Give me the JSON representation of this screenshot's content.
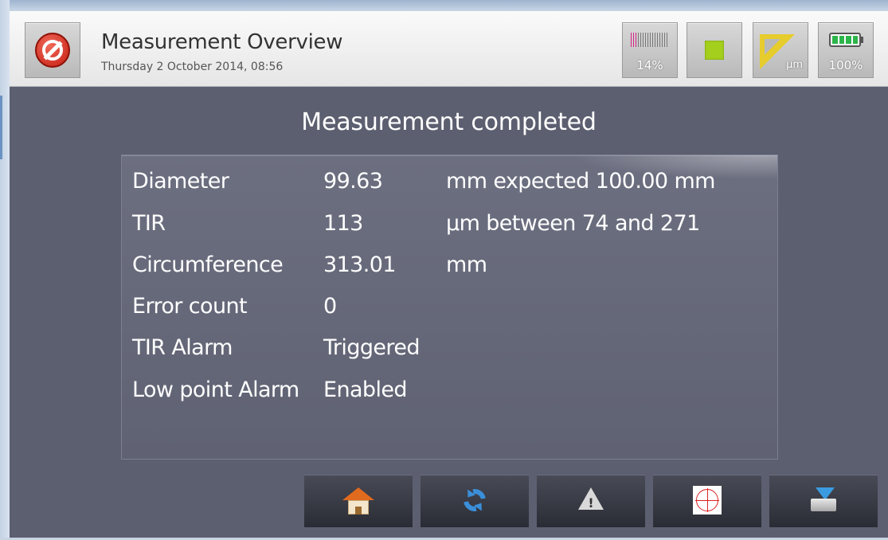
{
  "header": {
    "title": "Measurement Overview",
    "subtitle": "Thursday 2 October 2014, 08:56",
    "storage_level": "14%",
    "storage_fraction": 0.14,
    "unit_label": "µm",
    "battery_level": "100%",
    "battery_fraction": 1.0,
    "status_color": "#a4cf1c",
    "icons": {
      "cancel": "cancel-icon",
      "storage": "storage-bars-icon",
      "status": "status-square-icon",
      "unit": "ruler-icon",
      "battery": "battery-icon"
    }
  },
  "main": {
    "headline": "Measurement completed",
    "rows": [
      {
        "label": "Diameter",
        "value": "99.63",
        "extra": "mm expected 100.00 mm"
      },
      {
        "label": "TIR",
        "value": "113",
        "extra": "µm between 74 and 271"
      },
      {
        "label": "Circumference",
        "value": "313.01",
        "extra": "mm"
      },
      {
        "label": "Error count",
        "value": "0",
        "extra": ""
      },
      {
        "label": "TIR Alarm",
        "value": "Triggered",
        "extra": ""
      },
      {
        "label": "Low point Alarm",
        "value": "Enabled",
        "extra": ""
      }
    ]
  },
  "toolbar": {
    "icons": [
      "home-icon",
      "refresh-icon",
      "warning-icon",
      "target-icon",
      "export-icon"
    ]
  }
}
